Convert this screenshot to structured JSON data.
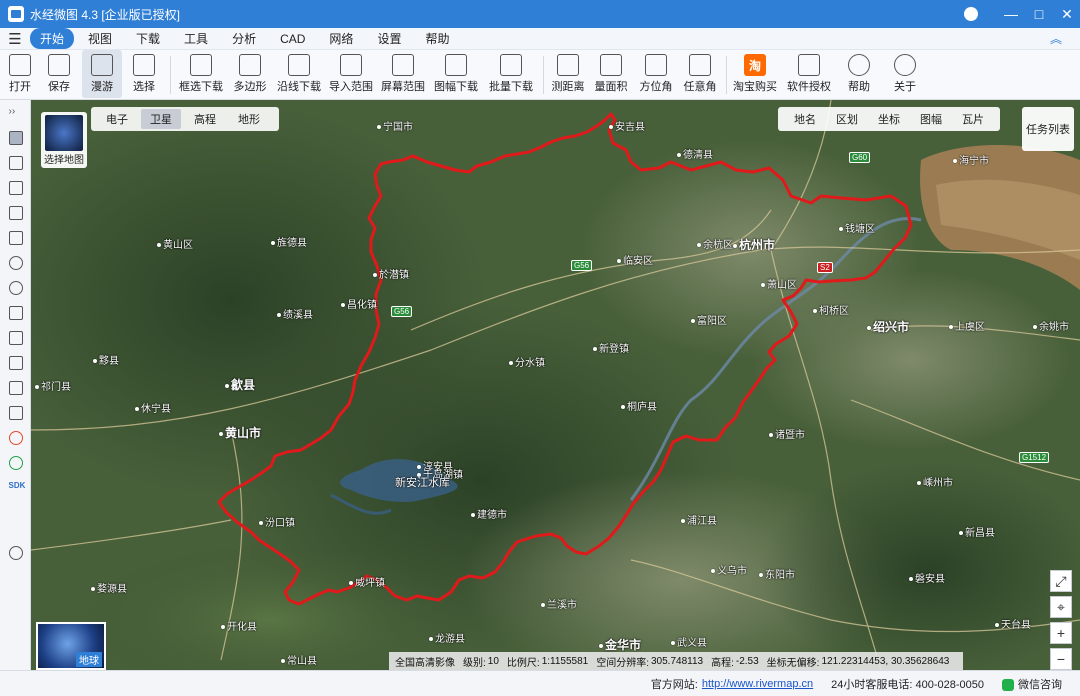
{
  "window": {
    "title": "水经微图 4.3 [企业版已授权]",
    "controls": [
      "—",
      "□",
      "✕"
    ]
  },
  "menu": {
    "items": [
      {
        "label": "开始",
        "active": true
      },
      {
        "label": "视图"
      },
      {
        "label": "下载"
      },
      {
        "label": "工具"
      },
      {
        "label": "分析"
      },
      {
        "label": "CAD"
      },
      {
        "label": "网络"
      },
      {
        "label": "设置"
      },
      {
        "label": "帮助"
      }
    ]
  },
  "toolbar": {
    "open": "打开",
    "save": "保存",
    "pan": "漫游",
    "select": "选择",
    "box_download": "框选下载",
    "polygon": "多边形",
    "line_download": "沿线下载",
    "import_range": "导入范围",
    "screen_range": "屏幕范围",
    "sheet_download": "图幅下载",
    "batch_download": "批量下载",
    "measure_distance": "测距离",
    "measure_area": "量面积",
    "azimuth": "方位角",
    "any_angle": "任意角",
    "taobao": "淘宝购买",
    "taobao_icon": "淘",
    "license": "软件授权",
    "help": "帮助",
    "about": "关于"
  },
  "map": {
    "types": [
      {
        "label": "电子"
      },
      {
        "label": "卫星",
        "active": true
      },
      {
        "label": "高程"
      },
      {
        "label": "地形"
      }
    ],
    "select_map": "选择地图",
    "layers": [
      "地名",
      "区划",
      "坐标",
      "图幅",
      "瓦片"
    ],
    "task_list": "任务列表",
    "globe_label": "地球",
    "lake_label": "新安江水库",
    "places": [
      {
        "name": "杭州市",
        "big": true
      },
      {
        "name": "黄山市",
        "big": true
      },
      {
        "name": "绍兴市",
        "big": true
      },
      {
        "name": "金华市",
        "big": true
      },
      {
        "name": "富阳区"
      },
      {
        "name": "余杭区"
      },
      {
        "name": "萧山区"
      },
      {
        "name": "钱塘区"
      },
      {
        "name": "临安区"
      },
      {
        "name": "桐庐县"
      },
      {
        "name": "建德市"
      },
      {
        "name": "淳安县"
      },
      {
        "name": "兰溪市"
      },
      {
        "name": "诸暨市"
      },
      {
        "name": "浦江县"
      },
      {
        "name": "义乌市"
      },
      {
        "name": "东阳市"
      },
      {
        "name": "歙县"
      },
      {
        "name": "休宁县"
      },
      {
        "name": "黟县"
      },
      {
        "name": "绩溪县"
      },
      {
        "name": "宁国市"
      },
      {
        "name": "安吉县"
      },
      {
        "name": "德清县"
      },
      {
        "name": "海宁市"
      },
      {
        "name": "上虞区"
      },
      {
        "name": "柯桥区"
      },
      {
        "name": "嵊州市"
      },
      {
        "name": "新昌县"
      },
      {
        "name": "婺源县"
      },
      {
        "name": "开化县"
      },
      {
        "name": "常山县"
      },
      {
        "name": "旌德县"
      },
      {
        "name": "黄山区"
      },
      {
        "name": "祁门县"
      },
      {
        "name": "余姚市"
      },
      {
        "name": "天台县"
      },
      {
        "name": "磐安县"
      },
      {
        "name": "武义县"
      },
      {
        "name": "龙游县"
      },
      {
        "name": "於潜镇"
      },
      {
        "name": "昌化镇"
      },
      {
        "name": "汾口镇"
      },
      {
        "name": "威坪镇"
      },
      {
        "name": "千岛湖镇"
      },
      {
        "name": "分水镇"
      },
      {
        "name": "新登镇"
      },
      {
        "name": "安吉县"
      }
    ],
    "roads": [
      "G56",
      "G56",
      "G60",
      "S2",
      "G1512"
    ],
    "status": {
      "source": "全国高清影像",
      "level_label": "级别:",
      "level": "10",
      "scale_label": "比例尺:",
      "scale": "1:1155581",
      "res_label": "空间分辨率:",
      "resolution": "305.748113",
      "elev_label": "高程:",
      "elevation": "-2.53",
      "coord_label": "坐标无偏移:",
      "coords": "121.22314453, 30.35628643"
    }
  },
  "bottom": {
    "site_label": "官方网站:",
    "site_url": "http://www.rivermap.cn",
    "hotline": "24小时客服电话: 400-028-0050",
    "wechat": "微信咨询"
  }
}
